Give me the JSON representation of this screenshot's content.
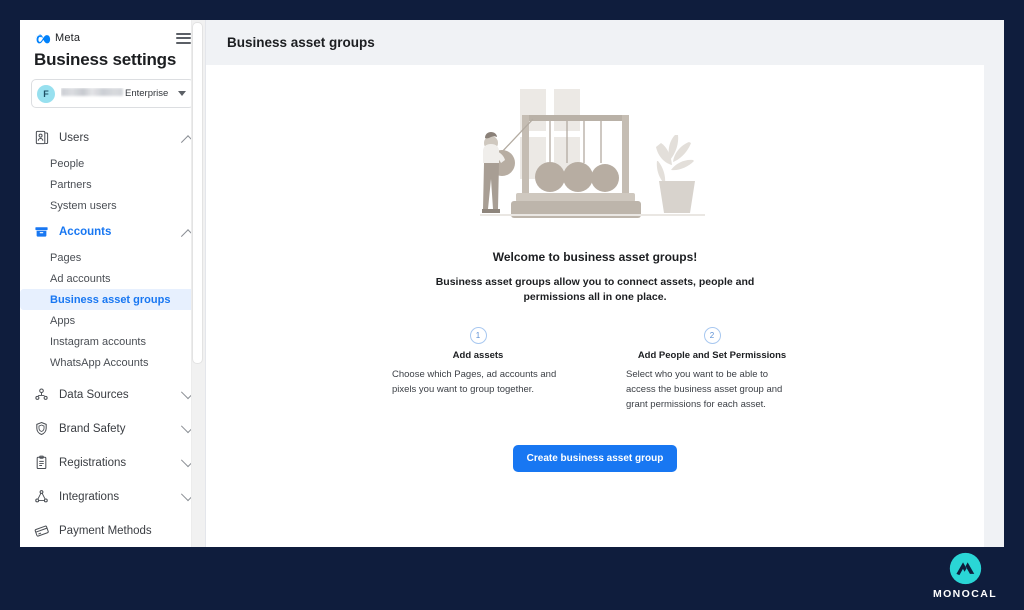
{
  "brand": {
    "logo_icon": "meta-logo-icon",
    "logo_word": "Meta",
    "menu_icon": "hamburger-menu-icon",
    "panel_title": "Business settings"
  },
  "account_selector": {
    "avatar_initial": "F",
    "name_suffix": "Enterprise",
    "name_redacted": true,
    "caret_icon": "chevron-down-icon"
  },
  "sidebar": {
    "groups": [
      {
        "label": "Users",
        "icon": "users-card-icon",
        "expanded": true,
        "active": false,
        "chevron_icon": "chevron-up-icon",
        "items": [
          {
            "label": "People",
            "selected": false
          },
          {
            "label": "Partners",
            "selected": false
          },
          {
            "label": "System users",
            "selected": false
          }
        ]
      },
      {
        "label": "Accounts",
        "icon": "accounts-box-icon",
        "expanded": true,
        "active": true,
        "chevron_icon": "chevron-up-icon",
        "items": [
          {
            "label": "Pages",
            "selected": false
          },
          {
            "label": "Ad accounts",
            "selected": false
          },
          {
            "label": "Business asset groups",
            "selected": true
          },
          {
            "label": "Apps",
            "selected": false
          },
          {
            "label": "Instagram accounts",
            "selected": false
          },
          {
            "label": "WhatsApp Accounts",
            "selected": false
          }
        ]
      },
      {
        "label": "Data Sources",
        "icon": "data-sources-icon",
        "expanded": false,
        "active": false,
        "chevron_icon": "chevron-down-icon",
        "items": []
      },
      {
        "label": "Brand Safety",
        "icon": "shield-icon",
        "expanded": false,
        "active": false,
        "chevron_icon": "chevron-down-icon",
        "items": []
      },
      {
        "label": "Registrations",
        "icon": "clipboard-icon",
        "expanded": false,
        "active": false,
        "chevron_icon": "chevron-down-icon",
        "items": []
      },
      {
        "label": "Integrations",
        "icon": "integrations-node-icon",
        "expanded": false,
        "active": false,
        "chevron_icon": "chevron-down-icon",
        "items": []
      },
      {
        "label": "Payment Methods",
        "icon": "payment-card-icon",
        "expanded": null,
        "active": false,
        "chevron_icon": null,
        "items": []
      }
    ]
  },
  "main": {
    "header_title": "Business asset groups",
    "illustration_name": "newtons-cradle-illustration",
    "welcome_title": "Welcome to business asset groups!",
    "welcome_subtitle": "Business asset groups allow you to connect assets, people and permissions all in one place.",
    "steps": [
      {
        "number": "1",
        "title": "Add assets",
        "body": "Choose which Pages, ad accounts and pixels you want to group together."
      },
      {
        "number": "2",
        "title": "Add People and Set Permissions",
        "body": "Select who you want to be able to access the business asset group and grant permissions for each asset."
      }
    ],
    "cta_label": "Create business asset group"
  },
  "watermark": {
    "text": "MONOCAL",
    "logo_icon": "monocal-mountain-logo-icon"
  },
  "colors": {
    "backdrop": "#0f1d3d",
    "accent_blue": "#1877f2",
    "selected_item_bg": "#e7f0fe",
    "page_bg": "#f0f2f5",
    "watermark_cyan": "#2ad6d6"
  }
}
